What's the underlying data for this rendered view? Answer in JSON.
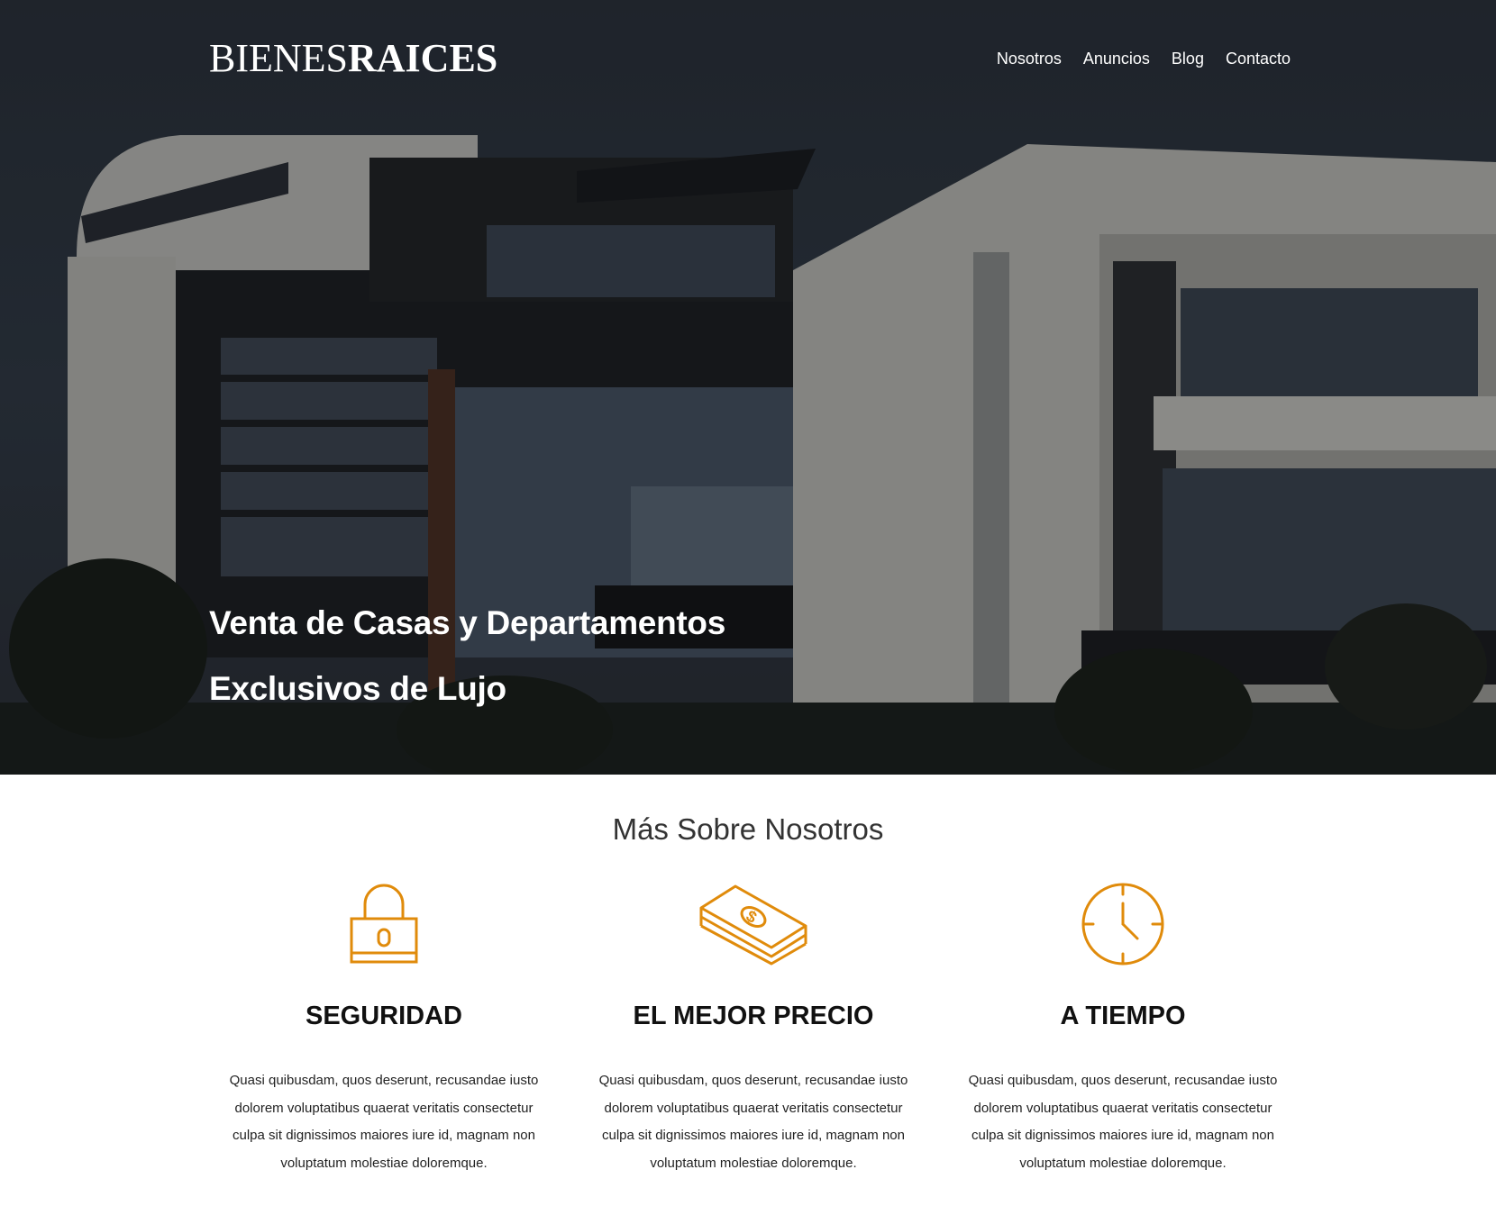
{
  "header": {
    "logo_light": "BIENES",
    "logo_bold": "RAICES",
    "nav": [
      {
        "label": "Nosotros"
      },
      {
        "label": "Anuncios"
      },
      {
        "label": "Blog"
      },
      {
        "label": "Contacto"
      }
    ]
  },
  "hero": {
    "line1": "Venta de Casas y Departamentos",
    "line2": "Exclusivos de Lujo"
  },
  "about": {
    "title": "Más Sobre Nosotros",
    "features": [
      {
        "icon": "lock-icon",
        "title": "SEGURIDAD",
        "text": "Quasi quibusdam, quos deserunt, recusandae iusto dolorem voluptatibus quaerat veritatis consectetur culpa sit dignissimos maiores iure id, magnam non voluptatum molestiae doloremque."
      },
      {
        "icon": "money-stack-icon",
        "title": "EL MEJOR PRECIO",
        "text": "Quasi quibusdam, quos deserunt, recusandae iusto dolorem voluptatibus quaerat veritatis consectetur culpa sit dignissimos maiores iure id, magnam non voluptatum molestiae doloremque."
      },
      {
        "icon": "clock-icon",
        "title": "A TIEMPO",
        "text": "Quasi quibusdam, quos deserunt, recusandae iusto dolorem voluptatibus quaerat veritatis consectetur culpa sit dignissimos maiores iure id, magnam non voluptatum molestiae doloremque."
      }
    ]
  },
  "colors": {
    "accent": "#e08b0b",
    "heading": "#111111",
    "hero_text": "#ffffff"
  }
}
